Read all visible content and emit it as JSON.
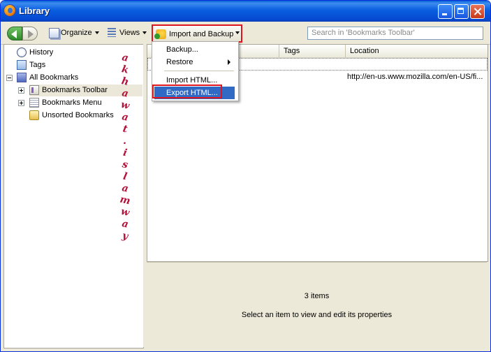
{
  "window": {
    "title": "Library"
  },
  "toolbar": {
    "organize_label": "Organize",
    "views_label": "Views",
    "import_backup_label": "Import and Backup",
    "search_placeholder": "Search in 'Bookmarks Toolbar'"
  },
  "sidebar": {
    "items": [
      {
        "label": "History",
        "icon": "clock-icon"
      },
      {
        "label": "Tags",
        "icon": "tag-icon"
      },
      {
        "label": "All Bookmarks",
        "icon": "star-icon"
      },
      {
        "label": "Bookmarks Toolbar",
        "icon": "bookmarks-toolbar-icon"
      },
      {
        "label": "Bookmarks Menu",
        "icon": "bookmarks-menu-icon"
      },
      {
        "label": "Unsorted Bookmarks",
        "icon": "unsorted-bookmarks-icon"
      }
    ]
  },
  "watermark": {
    "text": "akhawat.islamway"
  },
  "table": {
    "columns": [
      "Tags",
      "Location"
    ],
    "rows": [
      {
        "location": ""
      },
      {
        "location": "http://en-us.www.mozilla.com/en-US/fi..."
      }
    ]
  },
  "menu": {
    "backup": "Backup...",
    "restore": "Restore",
    "import_html": "Import HTML...",
    "export_html": "Export HTML..."
  },
  "details": {
    "count": "3 items",
    "hint": "Select an item to view and edit its properties"
  },
  "colors": {
    "highlight_border": "#e0141e",
    "menu_selected": "#316ac5",
    "title_bar": "#0a5ee0"
  }
}
